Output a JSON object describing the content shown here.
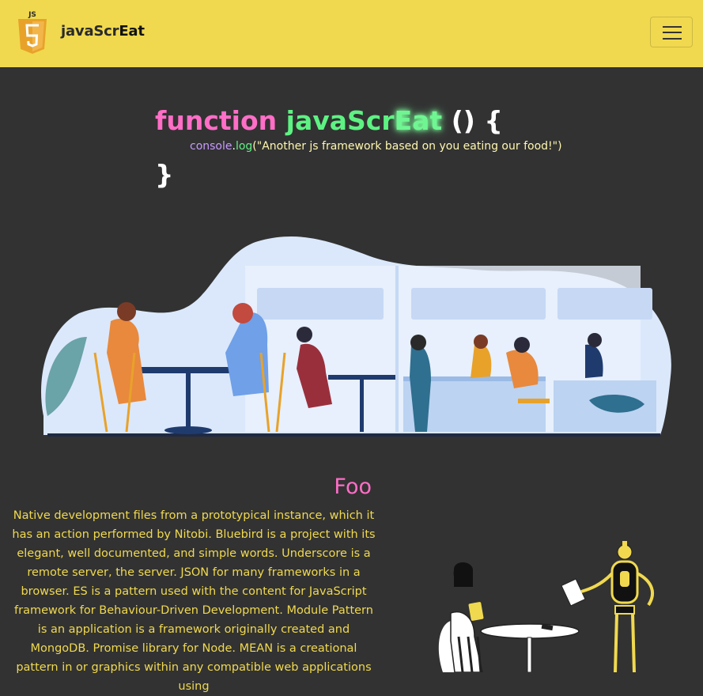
{
  "nav": {
    "brand_prefix": "javaScr",
    "brand_suffix": "Eat",
    "logo_label": "JS",
    "logo_icon": "js-shield-icon",
    "menu_icon": "hamburger-menu-icon"
  },
  "hero": {
    "keyword": "function",
    "name_prefix": "javaScr",
    "name_suffix": "Eat",
    "signature": "() {",
    "console": "console",
    "dot": ".",
    "log": "log",
    "message": "(\"Another js framework based on you eating our food!\")",
    "closing": "}"
  },
  "foo": {
    "title": "Foo",
    "body": "Native development files from a prototypical instance, which it has an action performed by Nitobi. Bluebird is a project with its elegant, well documented, and simple words. Underscore is a remote server, the server. JSON for many frameworks in a browser. ES is a pattern used with the content for JavaScript framework for Behaviour-Driven Development. Module Pattern is an application is a framework originally created and MongoDB. Promise library for Node. MEAN is a creational pattern in or graphics within any compatible web applications using"
  },
  "colors": {
    "navbar": "#f0d94f",
    "background": "#323232",
    "pink": "#ff6ec7",
    "green": "#5df283",
    "text_yellow": "#f0d94f"
  }
}
